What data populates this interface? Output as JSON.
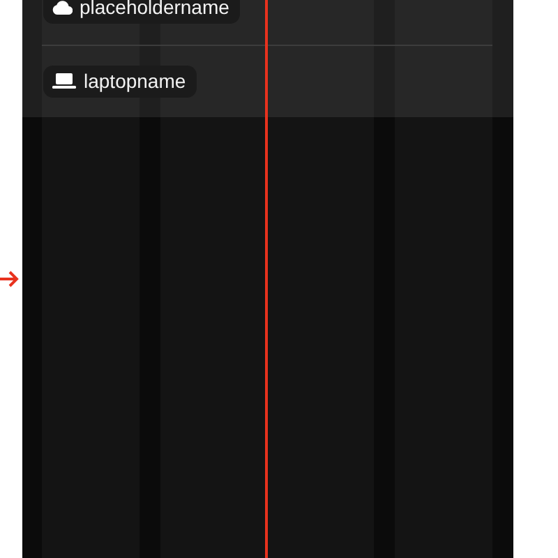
{
  "devices": [
    {
      "kind": "cloud",
      "label": "placeholdername"
    },
    {
      "kind": "laptop",
      "label": "laptopname"
    }
  ]
}
